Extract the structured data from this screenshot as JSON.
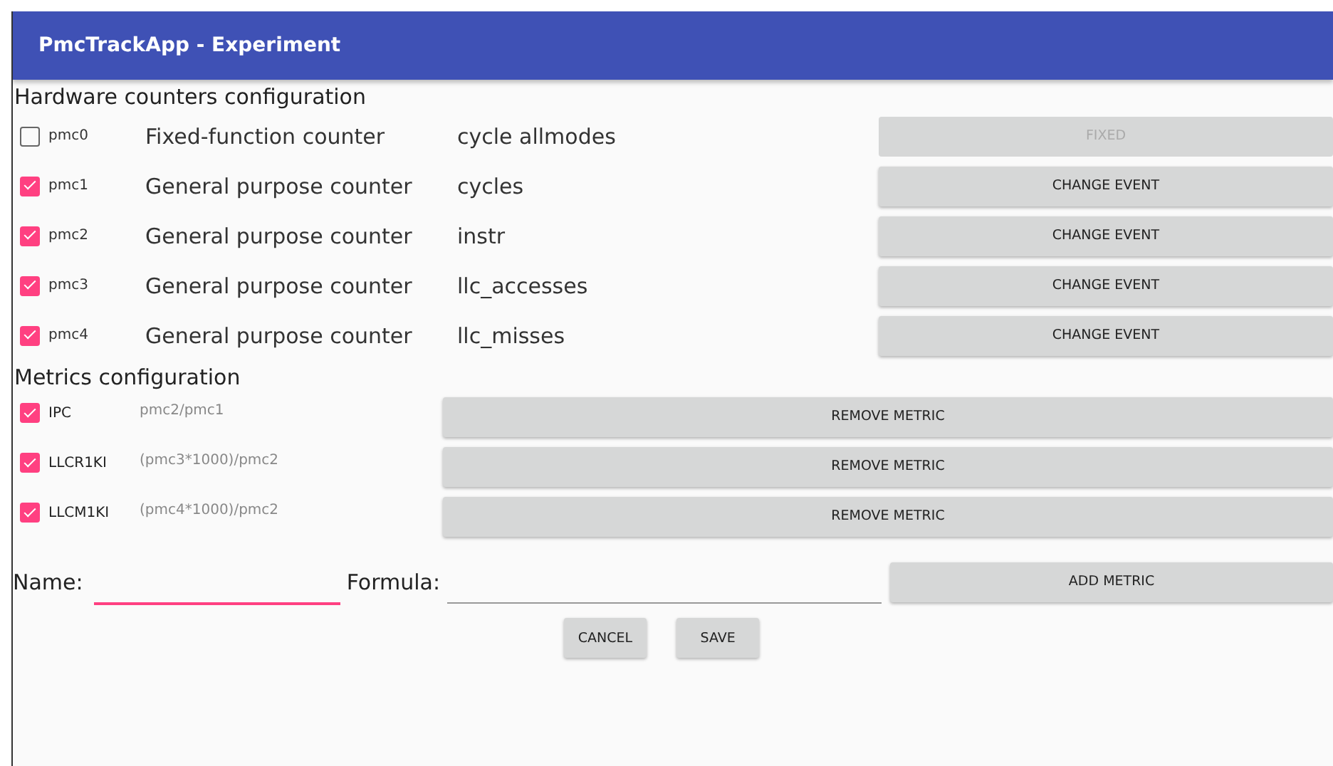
{
  "app_bar": {
    "title": "PmcTrackApp - Experiment"
  },
  "counters_heading": "Hardware counters configuration",
  "counters": [
    {
      "name": "pmc0",
      "checked": false,
      "type": "Fixed-function counter",
      "event": "cycle allmodes",
      "button": "FIXED",
      "disabled": true
    },
    {
      "name": "pmc1",
      "checked": true,
      "type": "General purpose counter",
      "event": "cycles",
      "button": "CHANGE EVENT",
      "disabled": false
    },
    {
      "name": "pmc2",
      "checked": true,
      "type": "General purpose counter",
      "event": "instr",
      "button": "CHANGE EVENT",
      "disabled": false
    },
    {
      "name": "pmc3",
      "checked": true,
      "type": "General purpose counter",
      "event": "llc_accesses",
      "button": "CHANGE EVENT",
      "disabled": false
    },
    {
      "name": "pmc4",
      "checked": true,
      "type": "General purpose counter",
      "event": "llc_misses",
      "button": "CHANGE EVENT",
      "disabled": false
    }
  ],
  "metrics_heading": "Metrics configuration",
  "metrics": [
    {
      "name": "IPC",
      "checked": true,
      "formula": "pmc2/pmc1",
      "button": "REMOVE METRIC"
    },
    {
      "name": "LLCR1KI",
      "checked": true,
      "formula": "(pmc3*1000)/pmc2",
      "button": "REMOVE METRIC"
    },
    {
      "name": "LLCM1KI",
      "checked": true,
      "formula": "(pmc4*1000)/pmc2",
      "button": "REMOVE METRIC"
    }
  ],
  "new_metric": {
    "name_label": "Name:",
    "name_focused": true,
    "formula_label": "Formula:",
    "formula_focused": false,
    "button": "ADD METRIC"
  },
  "actions": [
    "CANCEL",
    "SAVE"
  ]
}
